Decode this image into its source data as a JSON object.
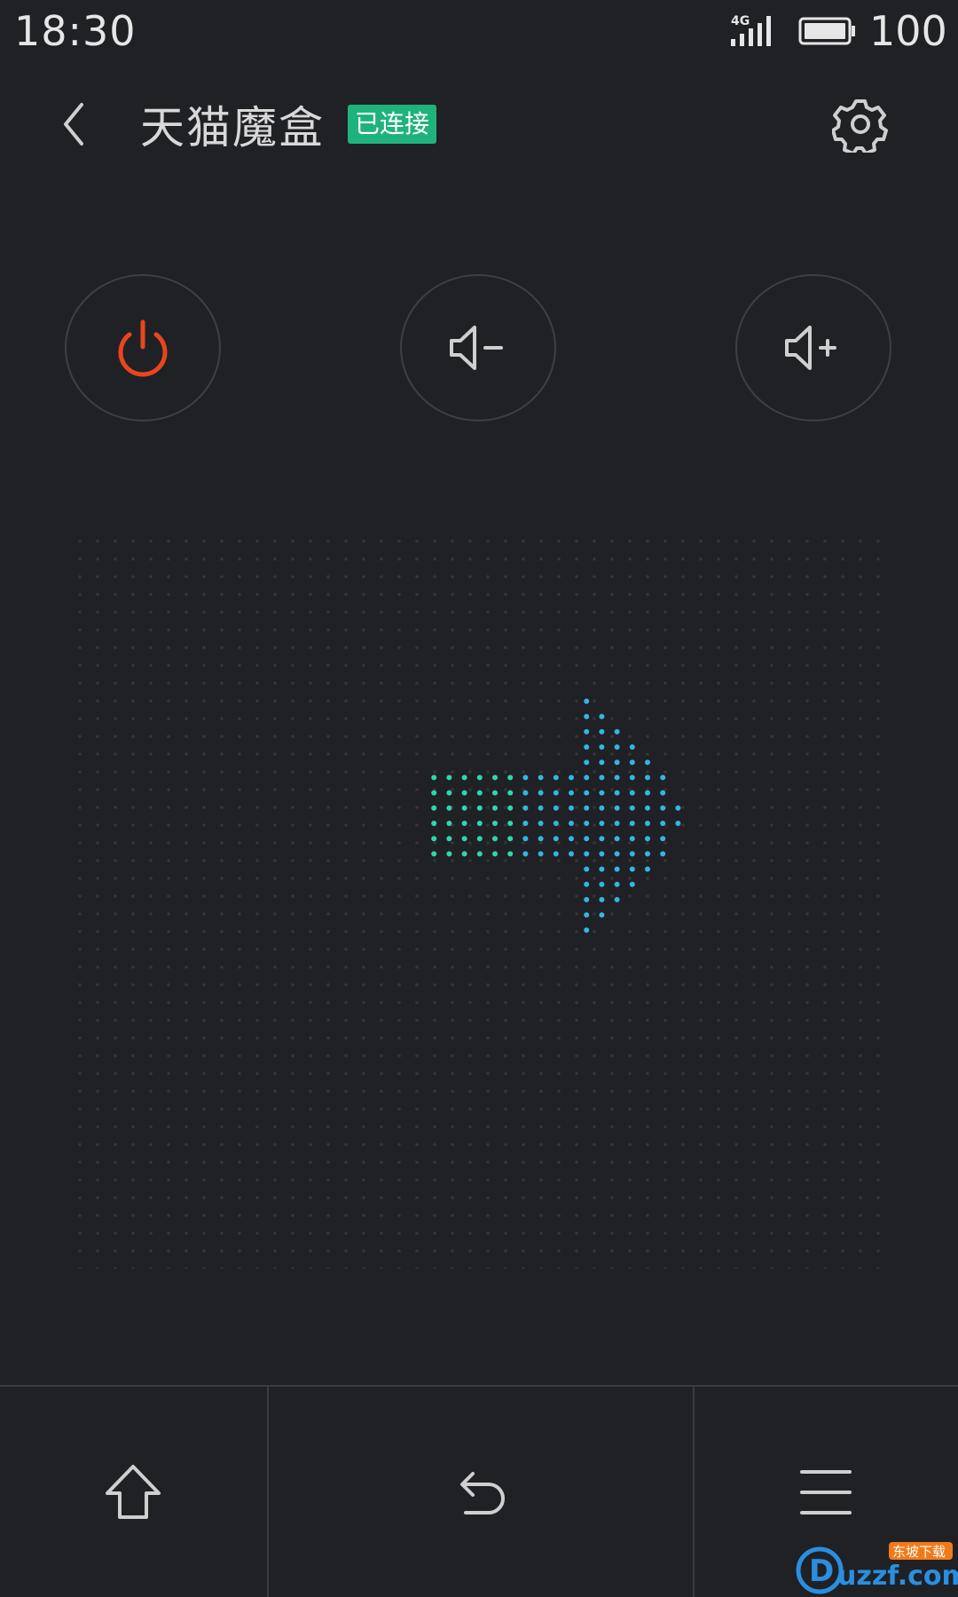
{
  "status_bar": {
    "time": "18:30",
    "network": "4G",
    "battery": "100"
  },
  "header": {
    "back_icon": "chevron-left-icon",
    "title": "天猫魔盒",
    "badge": "已连接",
    "settings_icon": "gear-icon"
  },
  "controls": {
    "power_icon": "power-icon",
    "volume_down_icon": "volume-down-icon",
    "volume_up_icon": "volume-up-icon"
  },
  "touchpad": {
    "gesture_icon": "arrow-right-icon"
  },
  "bottom_nav": {
    "home_icon": "home-icon",
    "back_icon": "return-icon",
    "menu_icon": "menu-icon"
  },
  "watermark": {
    "text": "uzzf.com",
    "tag": "东坡下载"
  },
  "colors": {
    "background": "#202125",
    "accent_badge": "#1fb37c",
    "power": "#e8461e",
    "arrow_green": "#2fd6b0",
    "arrow_blue": "#2fb8e0"
  }
}
